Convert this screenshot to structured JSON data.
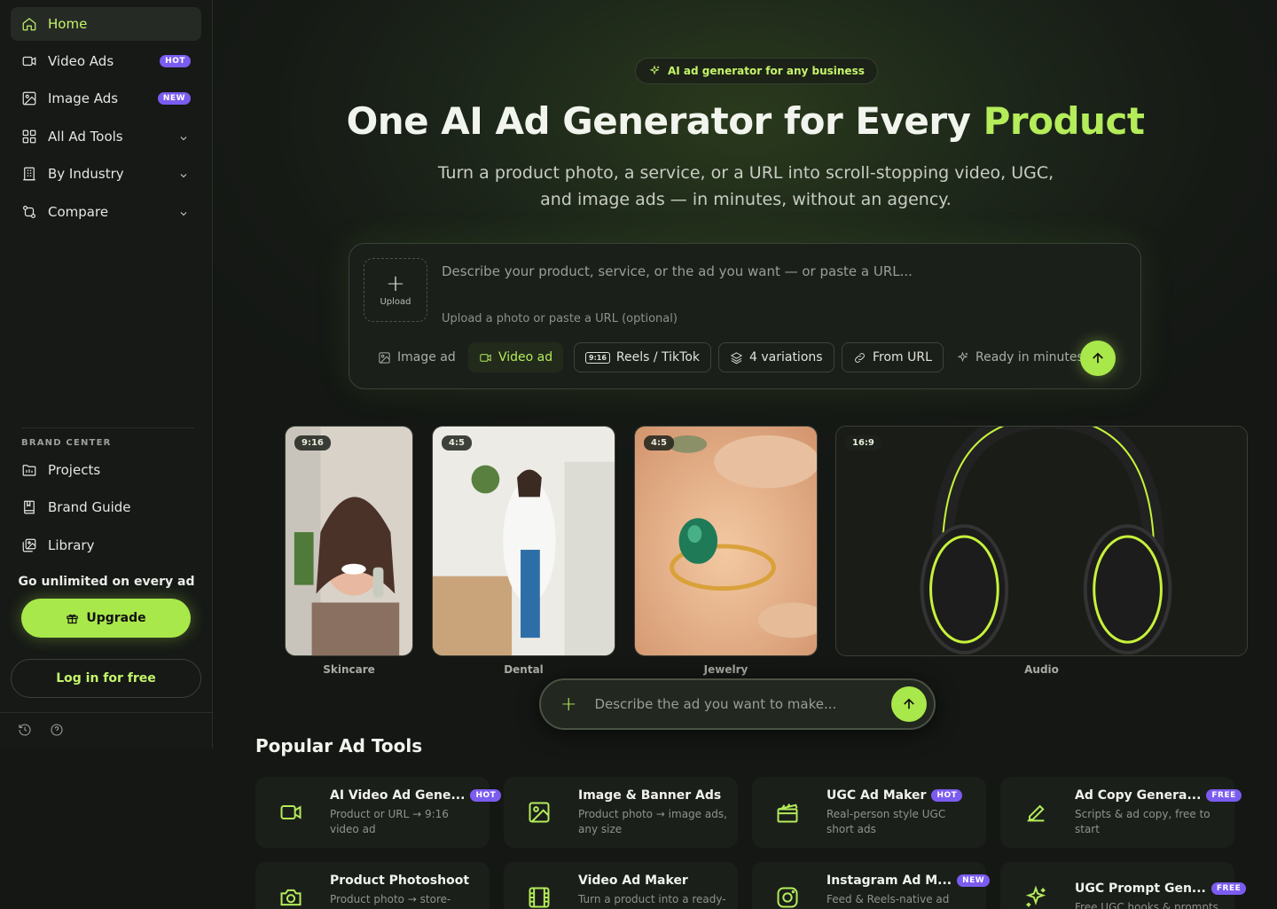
{
  "sidebar": {
    "nav": [
      {
        "label": "Home",
        "icon": "home-icon"
      },
      {
        "label": "Video Ads",
        "icon": "video-icon",
        "badge": "HOT"
      },
      {
        "label": "Image Ads",
        "icon": "image-icon",
        "badge": "NEW"
      },
      {
        "label": "All Ad Tools",
        "icon": "grid-icon"
      },
      {
        "label": "By Industry",
        "icon": "building-icon"
      },
      {
        "label": "Compare",
        "icon": "compare-icon"
      }
    ],
    "brand_center_title": "BRAND CENTER",
    "brand": [
      {
        "label": "Projects",
        "icon": "folder-icon"
      },
      {
        "label": "Brand Guide",
        "icon": "book-icon"
      },
      {
        "label": "Library",
        "icon": "library-icon"
      }
    ],
    "unlimited_text": "Go unlimited on every ad",
    "upgrade_label": "Upgrade",
    "login_label": "Log in for free"
  },
  "hero": {
    "badge": "AI ad generator for any business",
    "title_main": "One AI Ad Generator for Every ",
    "title_accent": "Product",
    "subtitle": "Turn a product photo, a service, or a URL into scroll-stopping video, UGC, and image ads — in minutes, without an agency."
  },
  "prompt": {
    "upload_label": "Upload",
    "placeholder": "Describe your product, service, or the ad you want — or paste a URL...",
    "hint": "Upload a photo or paste a URL (optional)",
    "chips": {
      "image_ad": "Image ad",
      "video_ad": "Video ad",
      "ratio_tag": "9:16",
      "reels": "Reels / TikTok",
      "variations": "4 variations",
      "from_url": "From URL",
      "ready": "Ready in minutes"
    }
  },
  "gallery": [
    {
      "ratio": "9:16",
      "caption": "Skincare"
    },
    {
      "ratio": "4:5",
      "caption": "Dental"
    },
    {
      "ratio": "4:5",
      "caption": "Jewelry"
    },
    {
      "ratio": "16:9",
      "caption": "Audio"
    }
  ],
  "float_input": {
    "placeholder": "Describe the ad you want to make..."
  },
  "tools": {
    "heading": "Popular Ad Tools",
    "items": [
      {
        "name": "AI Video Ad Gene...",
        "badge": "HOT",
        "desc": "Product or URL → 9:16 video ad",
        "icon": "video-icon"
      },
      {
        "name": "Image & Banner Ads",
        "badge": "",
        "desc": "Product photo → image ads, any size",
        "icon": "image-icon"
      },
      {
        "name": "UGC Ad Maker",
        "badge": "HOT",
        "desc": "Real-person style UGC short ads",
        "icon": "clapperboard-icon"
      },
      {
        "name": "Ad Copy Genera...",
        "badge": "FREE",
        "desc": "Scripts & ad copy, free to start",
        "icon": "pen-icon"
      },
      {
        "name": "Product Photoshoot",
        "badge": "",
        "desc": "Product photo → store-",
        "icon": "camera-icon"
      },
      {
        "name": "Video Ad Maker",
        "badge": "",
        "desc": "Turn a product into a ready-",
        "icon": "film-icon"
      },
      {
        "name": "Instagram Ad M...",
        "badge": "NEW",
        "desc": "Feed & Reels-native ad",
        "icon": "instagram-icon"
      },
      {
        "name": "UGC Prompt Gen...",
        "badge": "FREE",
        "desc": "Free UGC hooks & prompts",
        "icon": "sparkle-icon"
      }
    ]
  },
  "colors": {
    "accent": "#a9e84a",
    "badge_purple": "#7b5cf0",
    "background": "#141714"
  }
}
